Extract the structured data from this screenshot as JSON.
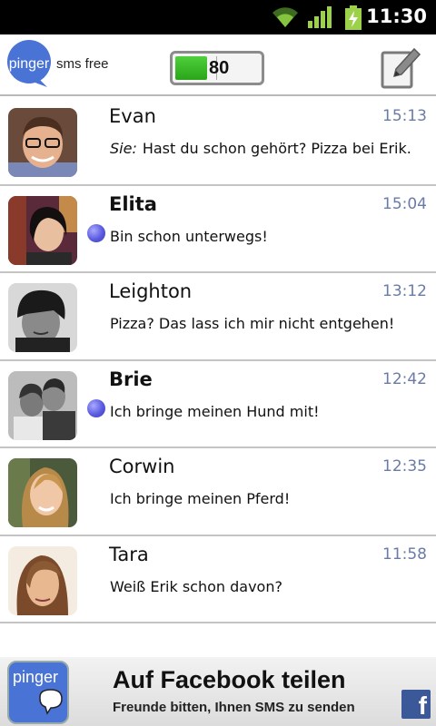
{
  "status_bar": {
    "time": "11:30",
    "icons": [
      "wifi-icon",
      "signal-icon",
      "battery-charging-icon"
    ]
  },
  "header": {
    "logo_text": "pinger",
    "app_subtitle": "sms free",
    "credit_value": "80",
    "credit_fraction": 0.36,
    "compose_icon": "compose-icon"
  },
  "conversations": [
    {
      "name": "Evan",
      "time": "15:13",
      "sender": "Sie:",
      "preview": "Hast du schon gehört?  Pizza bei Erik.",
      "unread": false
    },
    {
      "name": "Elita",
      "time": "15:04",
      "sender": "",
      "preview": "Bin schon unterwegs!",
      "unread": true
    },
    {
      "name": "Leighton",
      "time": "13:12",
      "sender": "",
      "preview": "Pizza? Das lass ich mir nicht entgehen!",
      "unread": false
    },
    {
      "name": "Brie",
      "time": "12:42",
      "sender": "",
      "preview": "Ich bringe meinen Hund mit!",
      "unread": true
    },
    {
      "name": "Corwin",
      "time": "12:35",
      "sender": "",
      "preview": "Ich bringe meinen Pferd!",
      "unread": false
    },
    {
      "name": "Tara",
      "time": "11:58",
      "sender": "",
      "preview": "Weiß Erik schon davon?",
      "unread": false
    }
  ],
  "banner": {
    "logo_text": "pinger",
    "title": "Auf Facebook teilen",
    "subtitle": "Freunde bitten, Ihnen SMS zu senden",
    "facebook_letter": "f"
  },
  "colors": {
    "accent_blue": "#4a73d6",
    "time_text": "#6a7ba8",
    "credit_green": "#2aa419",
    "unread_dot": "#5a5ae0",
    "facebook": "#3b5998"
  }
}
